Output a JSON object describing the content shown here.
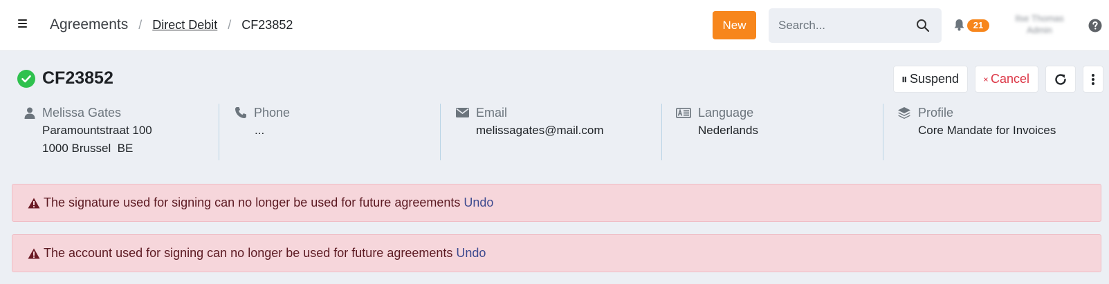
{
  "header": {
    "breadcrumb": {
      "root": "Agreements",
      "section": "Direct Debit",
      "current": "CF23852"
    },
    "new_label": "New",
    "search_placeholder": "Search...",
    "notification_count": "21",
    "user_name_line1": "Ilse Thomas",
    "user_name_line2": "Admin"
  },
  "agreement": {
    "title": "CF23852",
    "status_icon": "check-circle-icon",
    "status_color": "#2fc14e"
  },
  "actions": {
    "suspend_label": "Suspend",
    "cancel_label": "Cancel"
  },
  "info": {
    "contact": {
      "name": "Melissa Gates",
      "address_line1": "Paramountstraat 100",
      "address_line2": "1000 Brussel  BE"
    },
    "phone": {
      "label": "Phone",
      "value": "..."
    },
    "email": {
      "label": "Email",
      "value": "melissagates@mail.com"
    },
    "language": {
      "label": "Language",
      "value": "Nederlands"
    },
    "profile": {
      "label": "Profile",
      "value": "Core Mandate for Invoices"
    }
  },
  "alerts": [
    {
      "message": "The signature used for signing can no longer be used for future agreements",
      "action": "Undo"
    },
    {
      "message": "The account used for signing can no longer be used for future agreements",
      "action": "Undo"
    }
  ],
  "colors": {
    "accent": "#f7861c",
    "alert_bg": "#f6d6db",
    "alert_text": "#5c1a22",
    "cancel_red": "#dc3545",
    "success_green": "#2fc14e"
  }
}
